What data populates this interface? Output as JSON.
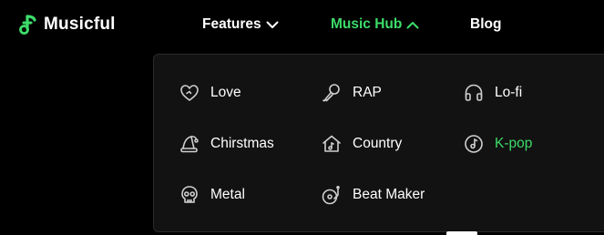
{
  "brand": {
    "name": "Musicful",
    "accent_color": "#3ddc6a"
  },
  "nav": {
    "features": {
      "label": "Features",
      "icon": "chevron-down-icon"
    },
    "music_hub": {
      "label": "Music Hub",
      "icon": "chevron-up-icon",
      "active": true
    },
    "blog": {
      "label": "Blog"
    }
  },
  "music_hub_menu": {
    "items": [
      {
        "label": "Love",
        "icon": "heart-icon"
      },
      {
        "label": "RAP",
        "icon": "microphone-icon"
      },
      {
        "label": "Lo-fi",
        "icon": "headphones-icon"
      },
      {
        "label": "Chirstmas",
        "icon": "santa-hat-icon"
      },
      {
        "label": "Country",
        "icon": "house-icon"
      },
      {
        "label": "K-pop",
        "icon": "music-disc-icon",
        "active": true
      },
      {
        "label": "Metal",
        "icon": "skull-icon"
      },
      {
        "label": "Beat Maker",
        "icon": "turntable-icon"
      }
    ]
  }
}
